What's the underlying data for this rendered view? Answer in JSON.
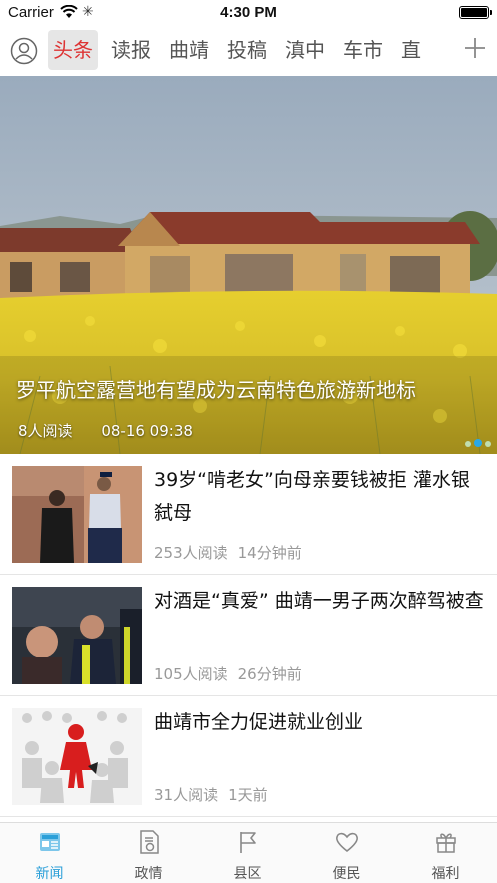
{
  "status_bar": {
    "carrier": "Carrier",
    "time": "4:30 PM"
  },
  "channels": [
    "头条",
    "读报",
    "曲靖",
    "投稿",
    "滇中",
    "车市",
    "直"
  ],
  "active_channel": 0,
  "hero": {
    "title": "罗平航空露营地有望成为云南特色旅游新地标",
    "reads": "8人阅读",
    "time": "08-16 09:38"
  },
  "news": [
    {
      "title": "39岁“啃老女”向母亲要钱被拒 灌水银弑母",
      "reads": "253人阅读",
      "time": "14分钟前"
    },
    {
      "title": "对酒是“真爱” 曲靖一男子两次醉驾被查",
      "reads": "105人阅读",
      "time": "26分钟前"
    },
    {
      "title": "曲靖市全力促进就业创业",
      "reads": "31人阅读",
      "time": "1天前"
    }
  ],
  "tab_bar": [
    {
      "label": "新闻",
      "icon": "news-icon",
      "active": true
    },
    {
      "label": "政情",
      "icon": "politics-doc-icon",
      "active": false
    },
    {
      "label": "县区",
      "icon": "flag-icon",
      "active": false
    },
    {
      "label": "便民",
      "icon": "heart-icon",
      "active": false
    },
    {
      "label": "福利",
      "icon": "gift-icon",
      "active": false
    }
  ],
  "colors": {
    "accent": "#2a9fd8",
    "active_channel_text": "#d33333"
  }
}
